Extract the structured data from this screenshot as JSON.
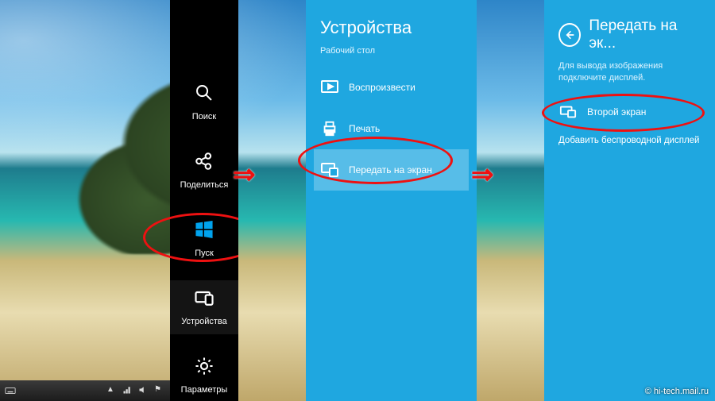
{
  "charms": {
    "search": "Поиск",
    "share": "Поделиться",
    "start": "Пуск",
    "devices": "Устройства",
    "settings": "Параметры"
  },
  "devices_pane": {
    "title": "Устройства",
    "subtitle": "Рабочий стол",
    "items": {
      "play": "Воспроизвести",
      "print": "Печать",
      "project": "Передать на экран"
    }
  },
  "project_pane": {
    "title": "Передать на эк...",
    "hint": "Для вывода изображения подключите дисплей.",
    "second_screen": "Второй экран",
    "add_wireless": "Добавить беспроводной дисплей"
  },
  "watermark": "© hi-tech.mail.ru",
  "colors": {
    "pane_bg": "#1fa7e0",
    "annotation": "#e11"
  }
}
